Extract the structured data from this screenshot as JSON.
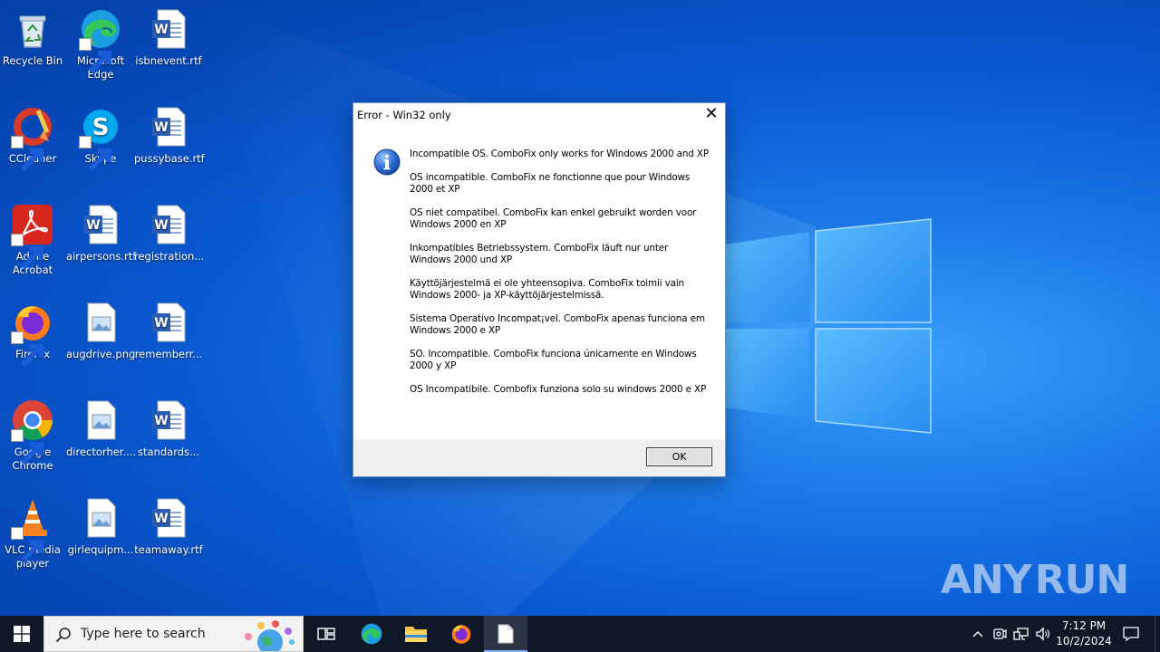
{
  "desktop": {
    "icons": [
      {
        "label": "Recycle Bin"
      },
      {
        "label": "Microsoft Edge"
      },
      {
        "label": "isbnevent.rtf"
      },
      {
        "label": "CCleaner"
      },
      {
        "label": "Skype"
      },
      {
        "label": "pussybase.rtf"
      },
      {
        "label": "Adobe Acrobat"
      },
      {
        "label": "airpersons.rtf"
      },
      {
        "label": "registration..."
      },
      {
        "label": "Firefox"
      },
      {
        "label": "augdrive.png"
      },
      {
        "label": "rememberr..."
      },
      {
        "label": "Google Chrome"
      },
      {
        "label": "directorher...."
      },
      {
        "label": "standards..."
      },
      {
        "label": "VLC media player"
      },
      {
        "label": "girlequipm..."
      },
      {
        "label": "teamaway.rtf"
      }
    ]
  },
  "dialog": {
    "title": "Error - Win32 only",
    "close_glyph": "✕",
    "messages": [
      "Incompatible OS. ComboFix only works for Windows 2000 and XP",
      "OS incompatible. ComboFix ne fonctionne que pour Windows 2000 et XP",
      "OS niet compatibel. ComboFix kan enkel gebruikt worden voor Windows 2000 en XP",
      "Inkompatibles Betriebssystem. ComboFix läuft nur unter Windows 2000 und XP",
      "Käyttöjärjestelmä ei ole yhteensopiva. ComboFix toimii vain Windows 2000- ja XP-käyttöjärjestelmissä.",
      "Sistema Operativo Incompat¡vel. ComboFix apenas funciona em Windows 2000 e XP",
      "SO. Incompatible. ComboFix funciona únicamente en Windows 2000 y XP",
      "OS Incompatibile. Combofix funziona solo su windows 2000 e XP"
    ],
    "ok_label": "OK"
  },
  "watermark": {
    "left": "ANY",
    "right": "RUN"
  },
  "taskbar": {
    "search_placeholder": "Type here to search",
    "clock_time": "7:12 PM",
    "clock_date": "10/2/2024"
  },
  "colors": {
    "taskbar_bg": "#101827",
    "dialog_border": "#6a8fc7",
    "info_icon_blue": "#1f5fc8"
  }
}
